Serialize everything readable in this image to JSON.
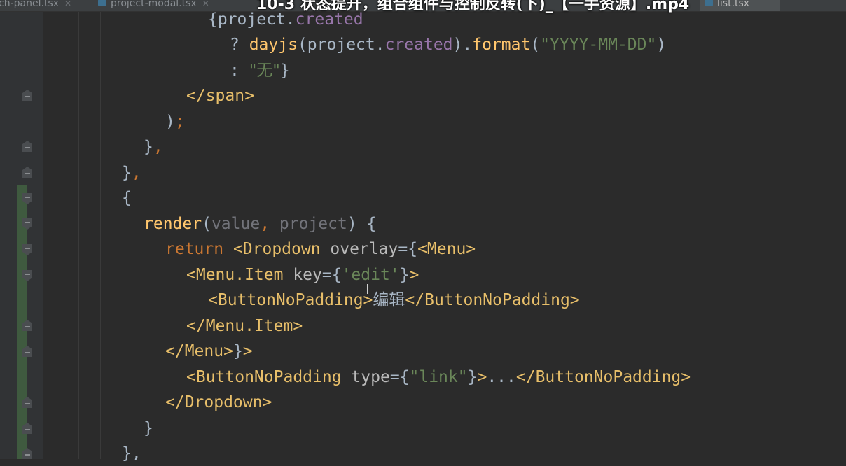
{
  "video_title": "10-3 状态提升，组合组件与控制反转(下)_【一手资源】.mp4",
  "tabs": [
    {
      "label": "ch-panel.tsx",
      "active": false
    },
    {
      "label": "project-modal.tsx",
      "active": false
    },
    {
      "label": "list.tsx",
      "active": true
    }
  ],
  "code": {
    "l1_open": "{",
    "l1_obj": "project",
    "l1_dot": ".",
    "l1_prop": "created",
    "l2_q": "? ",
    "l2_fn": "dayjs",
    "l2_a": "(project.",
    "l2_prop": "created",
    "l2_b": ").",
    "l2_fn2": "format",
    "l2_c": "(",
    "l2_str": "\"YYYY-MM-DD\"",
    "l2_d": ")",
    "l3_colon": ": ",
    "l3_str": "\"无\"",
    "l3_close": "}",
    "l4_tag": "</span>",
    "l5_paren": ")",
    "l5_semi": ";",
    "l6_brace": "}",
    "l6_comma": ",",
    "l7_brace": "}",
    "l7_comma": ",",
    "l8_brace": "{",
    "l9_fn": "render",
    "l9_open": "(",
    "l9_p1": "value",
    "l9_comma": ", ",
    "l9_p2": "project",
    "l9_close": ") {",
    "l10_kw": "return",
    "l10_tag": " <Dropdown",
    "l10_attr": " overlay",
    "l10_eq": "={",
    "l10_tag2": "<Menu>",
    "l11_tag": "<Menu.Item",
    "l11_attr": " key",
    "l11_eq": "={",
    "l11_str": "'edit'",
    "l11_close": "}",
    "l11_gt": ">",
    "l12_tag": "<ButtonNoPadding>",
    "l12_text": "编辑",
    "l12_tag2": "</ButtonNoPadding>",
    "l13_tag": "</Menu.Item>",
    "l14_tag": "</Menu>",
    "l14_close": "}",
    "l14_gt": ">",
    "l15_tag": "<ButtonNoPadding",
    "l15_attr": " type",
    "l15_eq": "={",
    "l15_str": "\"link\"",
    "l15_close": "}",
    "l15_gt": ">",
    "l15_text": "...",
    "l15_tag2": "</ButtonNoPadding>",
    "l16_tag": "</Dropdown>",
    "l17_brace": "}",
    "l18_brace": "},"
  },
  "colors": {
    "background": "#2b2b2b",
    "keyword": "#cc7832",
    "tag": "#e8bf6a",
    "string": "#6a8759",
    "property": "#9876aa",
    "function": "#ffc66d",
    "text": "#a9b7c6"
  },
  "icons": [
    "fold-marker-icon",
    "file-icon",
    "close-tab-icon"
  ]
}
